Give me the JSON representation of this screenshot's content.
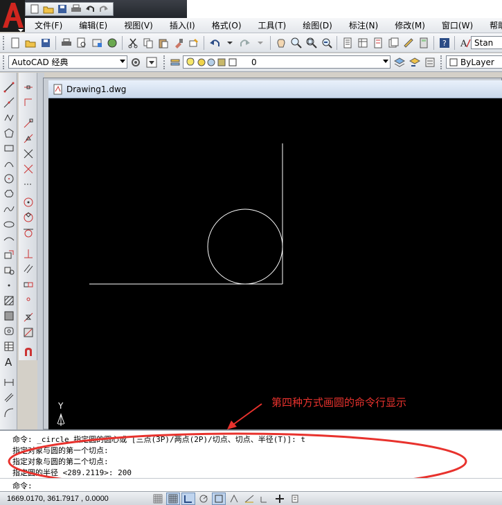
{
  "menu": [
    "文件(F)",
    "编辑(E)",
    "视图(V)",
    "插入(I)",
    "格式(O)",
    "工具(T)",
    "绘图(D)",
    "标注(N)",
    "修改(M)",
    "窗口(W)",
    "帮助("
  ],
  "workspace": {
    "value": "AutoCAD 经典"
  },
  "layer": {
    "value": "0"
  },
  "color_combo": {
    "value": "ByLayer"
  },
  "style_combo": {
    "value": "Stan"
  },
  "drawing": {
    "tab_title": "Drawing1.dwg",
    "ucs_y_label": "Y"
  },
  "annotation": {
    "text": "第四种方式画圆的命令行显示",
    "color": "#e8322d"
  },
  "command_history": [
    "命令: _circle 指定圆的圆心或 [三点(3P)/两点(2P)/切点、切点、半径(T)]: t",
    "指定对象与圆的第一个切点:",
    "指定对象与圆的第二个切点:",
    "指定圆的半径 <289.2119>: 200"
  ],
  "command_prompt": "命令:",
  "status": {
    "coordinates": "1669.0170, 361.7917 , 0.0000"
  },
  "colors": {
    "accent_red": "#d0261f",
    "canvas": "#000000",
    "linework": "#ffffff"
  }
}
